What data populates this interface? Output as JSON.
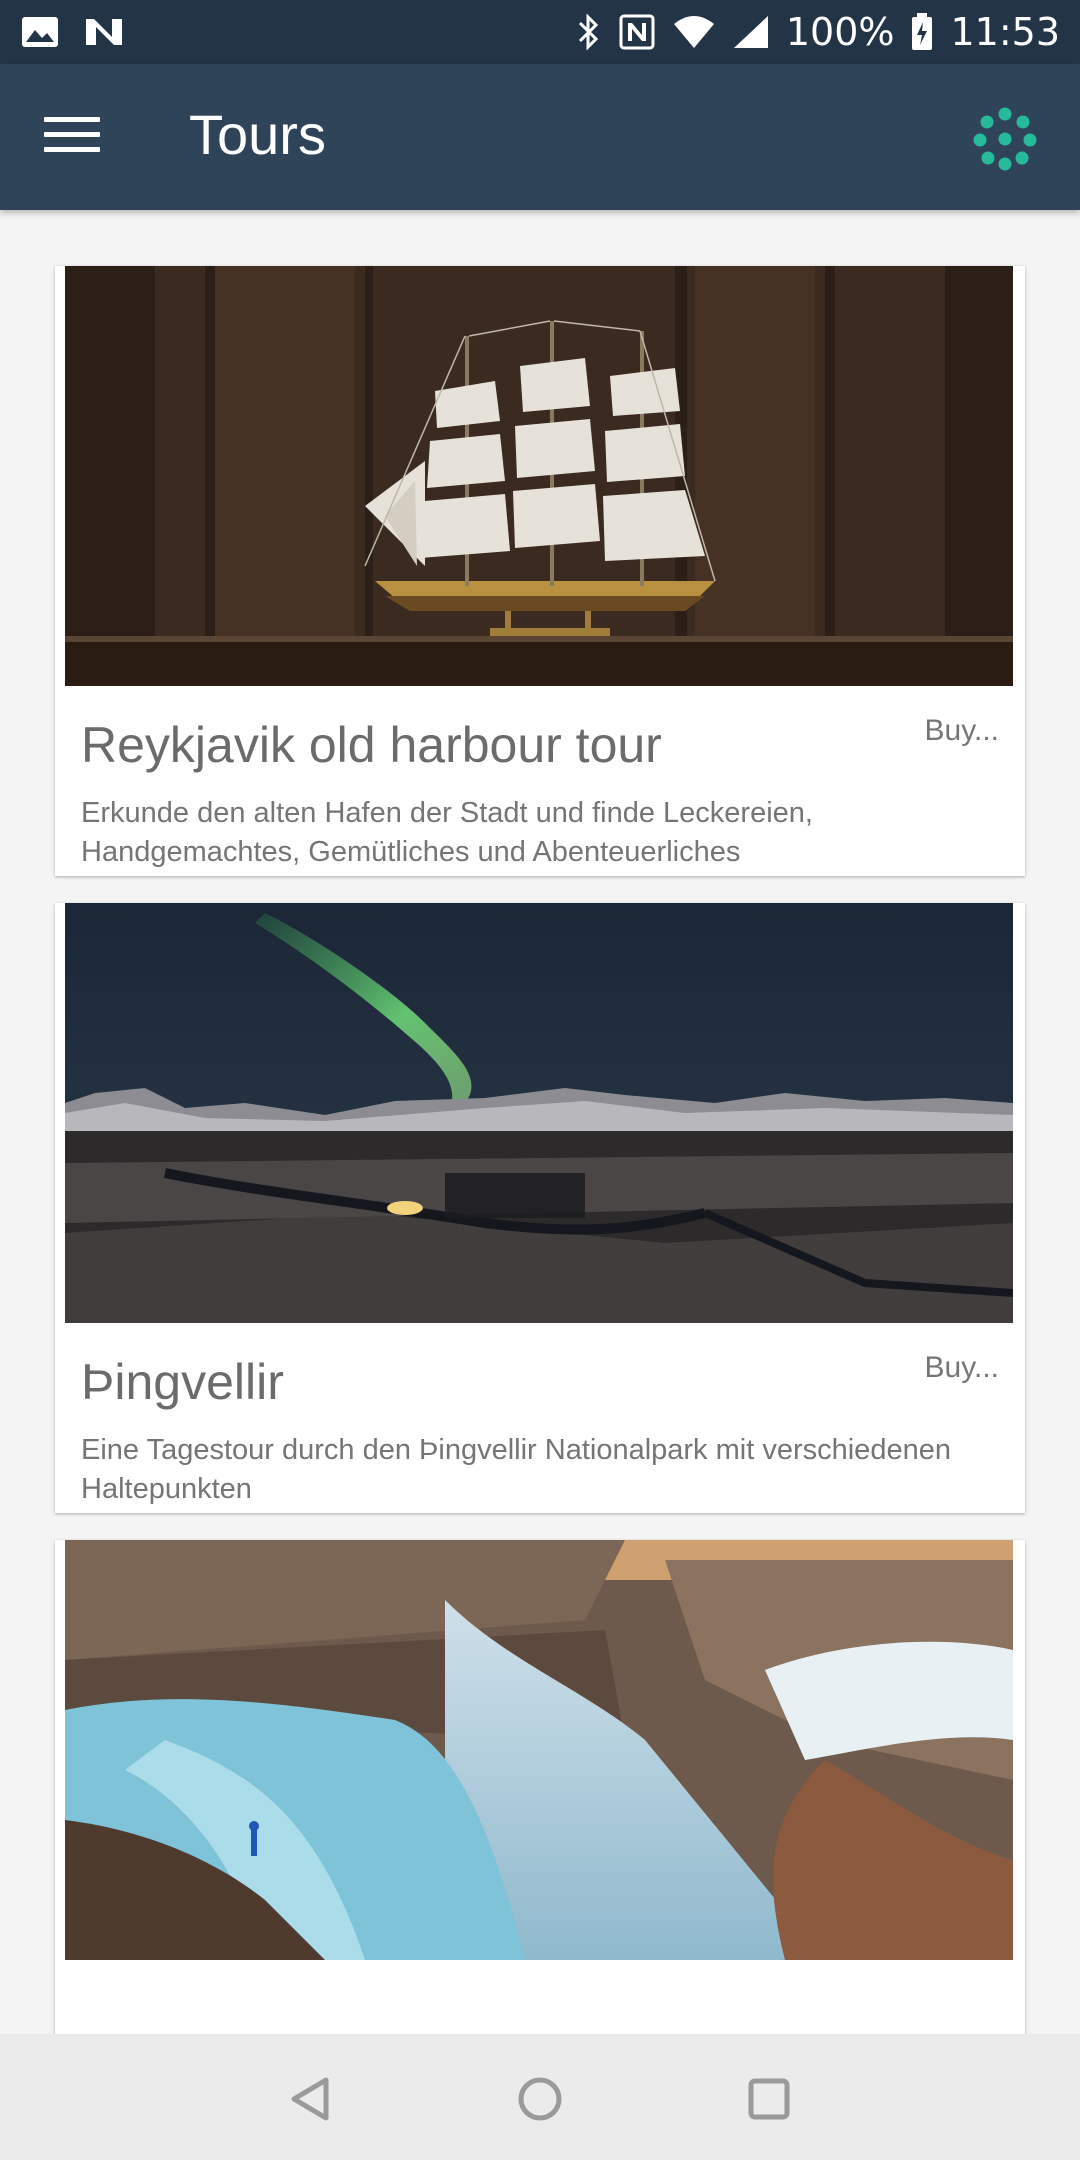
{
  "status_bar": {
    "icons_left": [
      "image-icon",
      "nfc-n-icon"
    ],
    "icons_right": [
      "bluetooth-icon",
      "nfc-icon",
      "wifi-icon",
      "signal-icon"
    ],
    "battery": "100%",
    "time": "11:53"
  },
  "app_bar": {
    "title": "Tours",
    "menu_icon": "hamburger-menu-icon",
    "action_icon": "dots-circle-icon",
    "accent_color": "#26b99a"
  },
  "tours": [
    {
      "title": "Reykjavik old harbour tour",
      "buy_label": "Buy...",
      "description": "Erkunde den alten Hafen der Stadt und finde Leckereien, Handgemachtes, Gemütliches und Abenteuerliches",
      "image": "ship-model-on-shelf"
    },
    {
      "title": "Þingvellir",
      "buy_label": "Buy...",
      "description": "Eine Tagestour durch den Þingvellir Nationalpark mit verschiedenen Haltepunkten",
      "image": "aurora-over-snowy-valley"
    },
    {
      "title": "",
      "buy_label": "",
      "description": "",
      "image": "waterfall-canyon"
    }
  ],
  "nav_bar": {
    "icons": [
      "back-icon",
      "home-icon",
      "recents-icon"
    ]
  },
  "colors": {
    "status_bar": "#243447",
    "app_bar": "#2f4459",
    "background": "#f4f4f4",
    "card": "#ffffff"
  }
}
